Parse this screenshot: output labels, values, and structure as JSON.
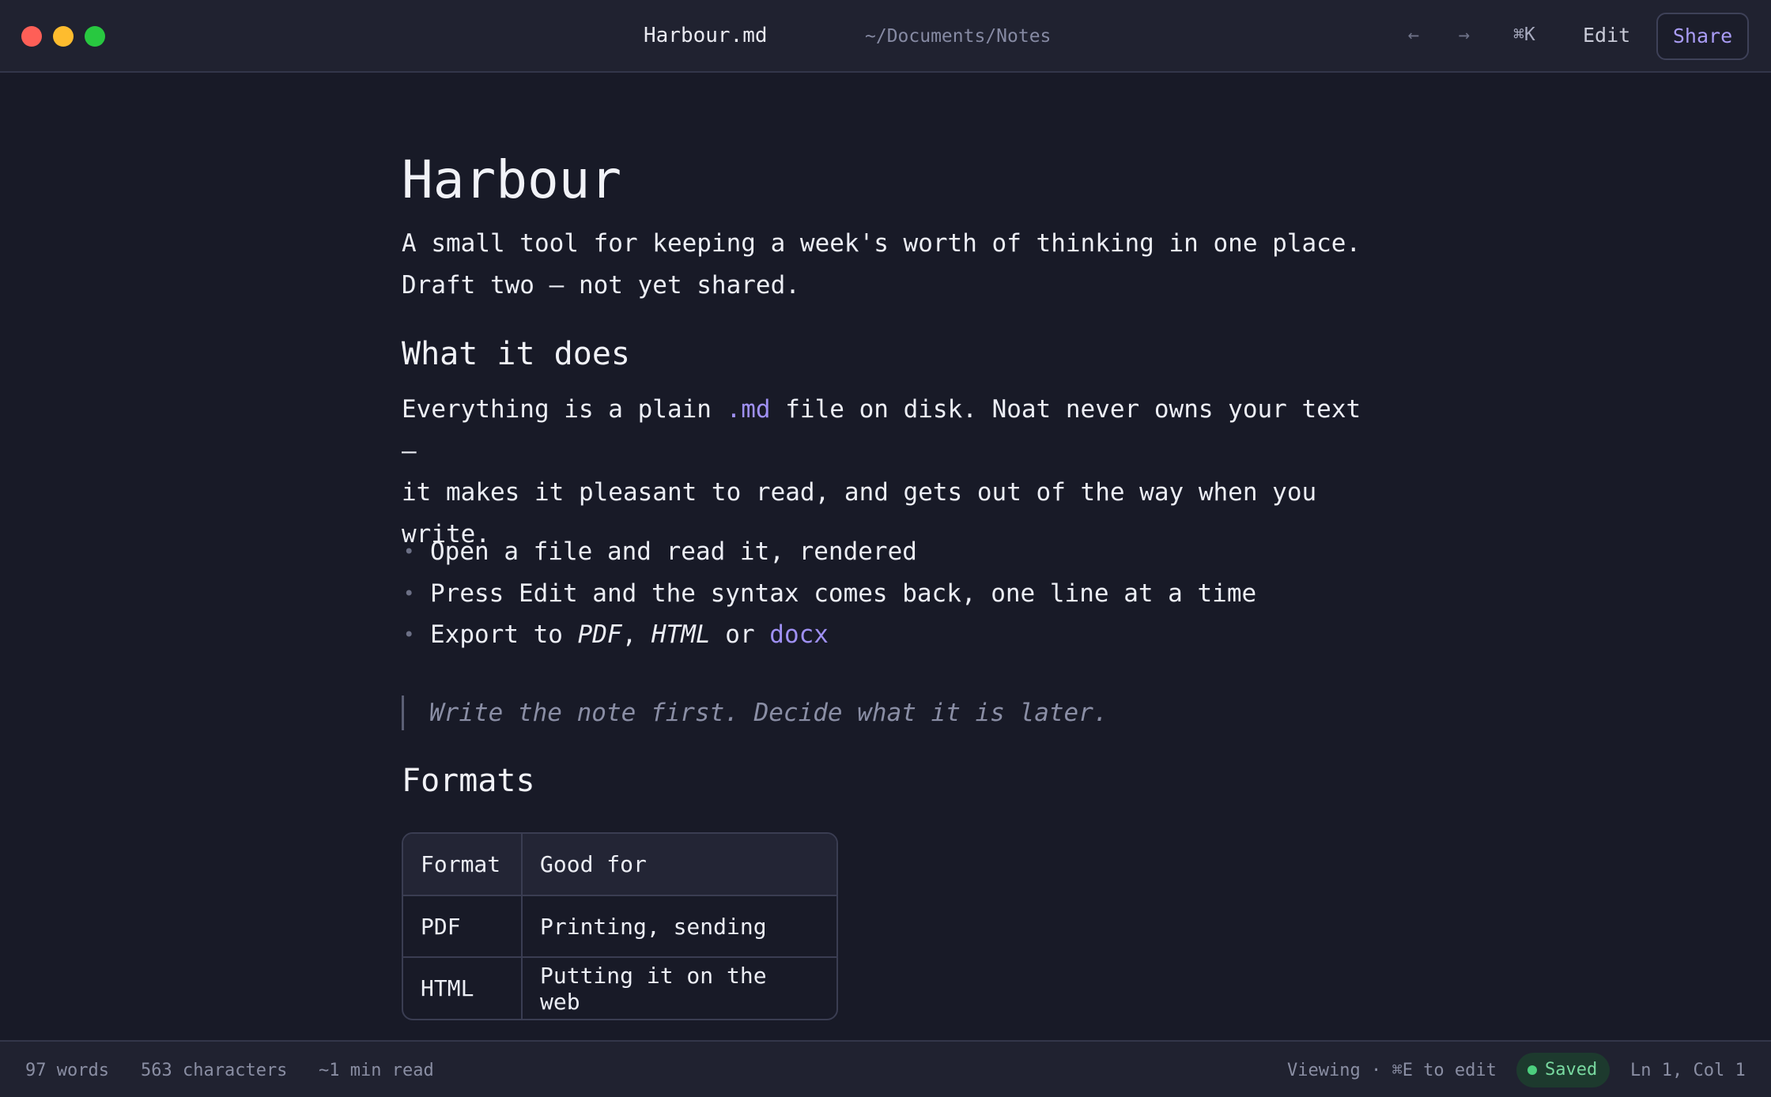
{
  "titlebar": {
    "file_name": "Harbour.md",
    "file_path": "~/Documents/Notes",
    "back_icon": "←",
    "forward_icon": "→",
    "command_palette": "⌘K",
    "edit_label": "Edit",
    "share_label": "Share"
  },
  "document": {
    "title": "Harbour",
    "intro_line1": "A small tool for keeping a week's worth of thinking in one place.",
    "intro_line2": "Draft two — not yet shared.",
    "section1_heading": "What it does",
    "section1_part1": "Everything is a plain ",
    "section1_code": ".md",
    "section1_part2": " file on disk. Noat never owns your text —",
    "section1_line2": "it makes it pleasant to read, and gets out of the way when you",
    "section1_line3": "write.",
    "bullets": {
      "item1": "Open a file and read it, rendered",
      "item2": "Press Edit and the syntax comes back, one line at a time",
      "item3_prefix": "Export to ",
      "item3_pdf": "PDF",
      "item3_sep": ", ",
      "item3_html": "HTML",
      "item3_or": " or ",
      "item3_docx": "docx"
    },
    "quote": "Write the note first. Decide what it is later.",
    "section2_heading": "Formats",
    "table": {
      "headers": [
        "Format",
        "Good for"
      ],
      "rows": [
        [
          "PDF",
          "Printing, sending"
        ],
        [
          "HTML",
          "Putting it on the web"
        ]
      ]
    }
  },
  "statusbar": {
    "words": "97 words",
    "characters": "563 characters",
    "read_time": "~1 min read",
    "mode": "Viewing · ⌘E to edit",
    "saved": "Saved",
    "position": "Ln 1, Col 1"
  },
  "colors": {
    "background": "#181a27",
    "titlebar": "#202230",
    "accent": "#9f90f3",
    "saved": "#4ccf7e"
  }
}
